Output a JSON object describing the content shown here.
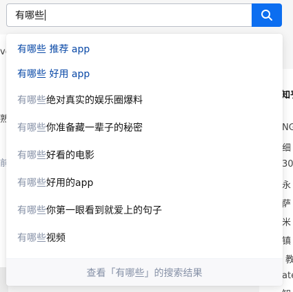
{
  "search": {
    "query": "有哪些"
  },
  "suggestions": [
    {
      "prefix": "有哪些",
      "rest": " 推荐 app",
      "style": "recommended"
    },
    {
      "prefix": "有哪些",
      "rest": " 好用 app",
      "style": "recommended"
    },
    {
      "prefix": "有哪些",
      "rest": "绝对真实的娱乐圈爆料",
      "style": "normal"
    },
    {
      "prefix": "有哪些",
      "rest": "你准备藏一辈子的秘密",
      "style": "normal"
    },
    {
      "prefix": "有哪些",
      "rest": "好看的电影",
      "style": "normal"
    },
    {
      "prefix": "有哪些",
      "rest": "好用的app",
      "style": "normal"
    },
    {
      "prefix": "有哪些",
      "rest": "你第一眼看到就爱上的句子",
      "style": "normal"
    },
    {
      "prefix": "有哪些",
      "rest": "视频",
      "style": "normal"
    }
  ],
  "footer": {
    "search_all": "查看「有哪些」的搜索结果"
  },
  "background": {
    "left_fragments": [
      "ve",
      "熟",
      "前"
    ],
    "right_heading": "知乎",
    "right_fragments": [
      "NG",
      "细",
      "30",
      "永",
      "萨",
      "米",
      "镇",
      "教",
      "ate",
      "知"
    ]
  },
  "colors": {
    "accent": "#0c6ef0",
    "recommended_text": "#0747a6",
    "muted_text": "#8590a6"
  },
  "icons": {
    "search_button": "search-icon"
  }
}
